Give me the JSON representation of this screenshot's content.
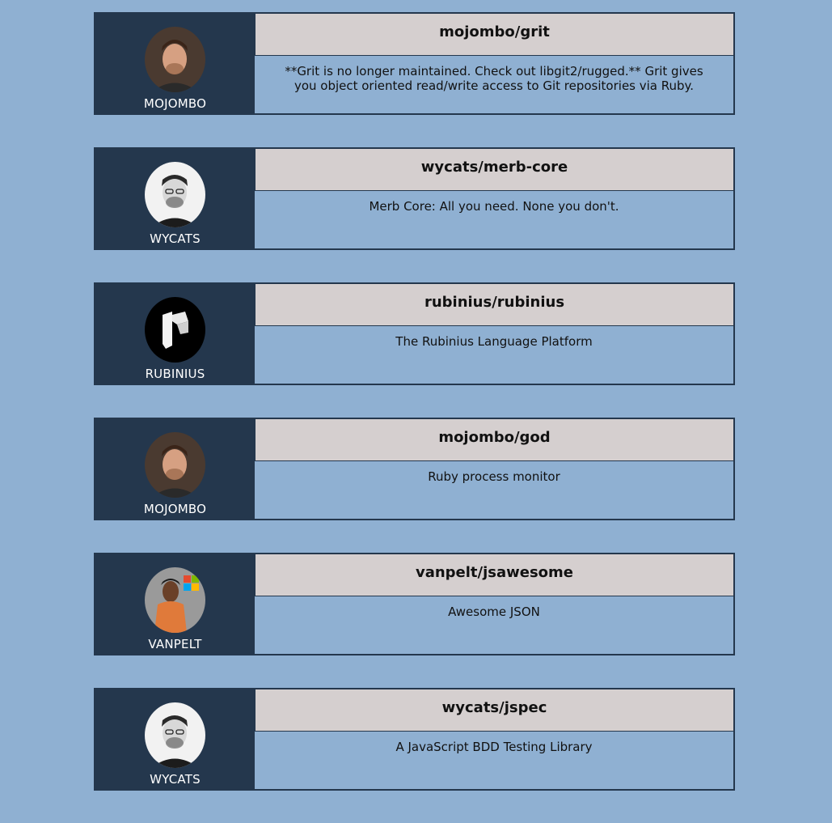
{
  "repos": [
    {
      "name": "mojombo/grit",
      "owner": "MOJOMBO",
      "description": "**Grit is no longer maintained. Check out libgit2/rugged.** Grit gives you object oriented read/write access to Git repositories via Ruby.",
      "avatar": "mojombo-avatar"
    },
    {
      "name": "wycats/merb-core",
      "owner": "WYCATS",
      "description": "Merb Core: All you need. None you don't.",
      "avatar": "wycats-avatar"
    },
    {
      "name": "rubinius/rubinius",
      "owner": "RUBINIUS",
      "description": "The Rubinius Language Platform",
      "avatar": "rubinius-avatar"
    },
    {
      "name": "mojombo/god",
      "owner": "MOJOMBO",
      "description": "Ruby process monitor",
      "avatar": "mojombo-avatar"
    },
    {
      "name": "vanpelt/jsawesome",
      "owner": "VANPELT",
      "description": "Awesome JSON",
      "avatar": "vanpelt-avatar"
    },
    {
      "name": "wycats/jspec",
      "owner": "WYCATS",
      "description": "A JavaScript BDD Testing Library",
      "avatar": "wycats-avatar"
    }
  ],
  "colors": {
    "page_background": "#8fb0d2",
    "owner_panel": "#24374d",
    "title_bar": "#d5cfcf",
    "border": "#24374d"
  }
}
